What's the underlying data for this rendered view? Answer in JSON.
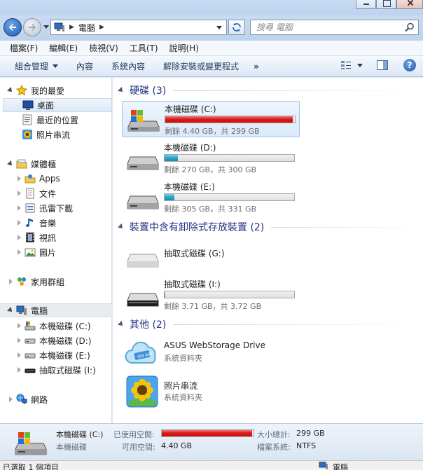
{
  "address": {
    "path": [
      "電腦"
    ],
    "search_placeholder": "搜尋 電腦"
  },
  "menu": [
    "檔案(F)",
    "編輯(E)",
    "檢視(V)",
    "工具(T)",
    "說明(H)"
  ],
  "commands": {
    "organize": "組合管理",
    "properties": "內容",
    "system_properties": "系統內容",
    "uninstall": "解除安裝或變更程式",
    "more": "»"
  },
  "nav": {
    "favorites": "我的最愛",
    "desktop": "桌面",
    "recent": "最近的位置",
    "slideshow": "照片串流",
    "libraries": "媒體櫃",
    "apps": "Apps",
    "documents": "文件",
    "downloads": "迅雷下載",
    "music": "音樂",
    "video": "視訊",
    "pictures": "圖片",
    "homegroup": "家用群組",
    "computer": "電腦",
    "drive_c": "本機磁碟 (C:)",
    "drive_d": "本機磁碟 (D:)",
    "drive_e": "本機磁碟 (E:)",
    "drive_i": "抽取式磁碟 (I:)",
    "network": "網路"
  },
  "groups": {
    "hard_disks": "硬碟 (3)",
    "removable": "裝置中含有卸除式存放裝置 (2)",
    "other": "其他 (2)"
  },
  "drives": [
    {
      "name": "本機磁碟 (C:)",
      "free_text": "剩餘 4.40 GB，共 299 GB",
      "used_fraction": 0.985,
      "bar_color": "#d31515"
    },
    {
      "name": "本機磁碟 (D:)",
      "free_text": "剩餘 270 GB，共 300 GB",
      "used_fraction": 0.1,
      "bar_color": "#26a5c8"
    },
    {
      "name": "本機磁碟 (E:)",
      "free_text": "剩餘 305 GB，共 331 GB",
      "used_fraction": 0.078,
      "bar_color": "#26a5c8"
    }
  ],
  "removable": [
    {
      "name": "抽取式磁碟 (G:)"
    },
    {
      "name": "抽取式磁碟 (I:)",
      "free_text": "剩餘 3.71 GB，共 3.72 GB",
      "used_fraction": 0.003
    }
  ],
  "other": [
    {
      "name": "ASUS WebStorage Drive",
      "sub": "系統資料夾"
    },
    {
      "name": "照片串流",
      "sub": "系統資料夾"
    }
  ],
  "details": {
    "name": "本機磁碟 (C:)",
    "type": "本機磁碟",
    "used_label": "已使用空間:",
    "free_label": "可用空間:",
    "free_value": "4.40 GB",
    "total_label": "大小總計:",
    "total_value": "299 GB",
    "fs_label": "檔案系統:",
    "fs_value": "NTFS",
    "used_fraction": 0.985
  },
  "status": {
    "left": "已選取 1 個項目",
    "right": "電腦"
  }
}
